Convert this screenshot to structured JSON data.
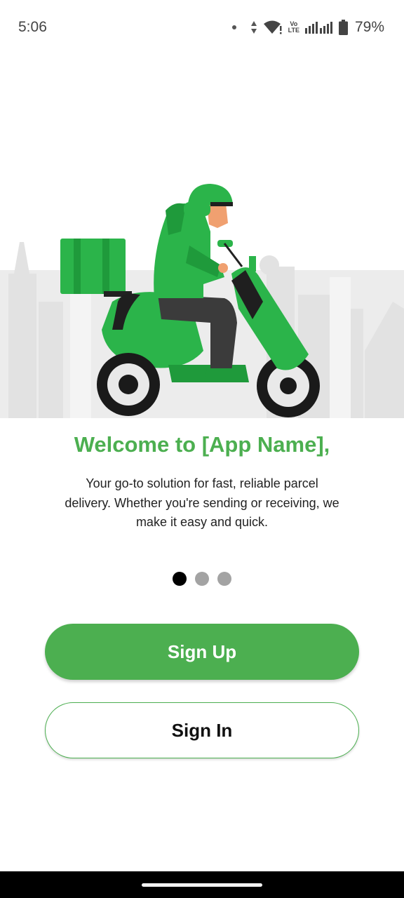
{
  "status_bar": {
    "time": "5:06",
    "volte_top": "Vo",
    "volte_bottom": "LTE",
    "battery_percent": "79%"
  },
  "onboarding": {
    "title": "Welcome to [App Name],",
    "description": "Your go-to solution for fast, reliable parcel delivery. Whether you're sending or receiving, we make it easy and quick.",
    "page_indicator": {
      "total": 3,
      "active_index": 0
    }
  },
  "actions": {
    "sign_up_label": "Sign Up",
    "sign_in_label": "Sign In"
  },
  "colors": {
    "brand_green": "#4caf50",
    "active_dot": "#000000",
    "inactive_dot": "#a3a3a3"
  },
  "icons": [
    "notification-dot-icon",
    "data-arrows-icon",
    "wifi-icon",
    "signal-icon",
    "battery-icon",
    "delivery-scooter-illustration"
  ]
}
